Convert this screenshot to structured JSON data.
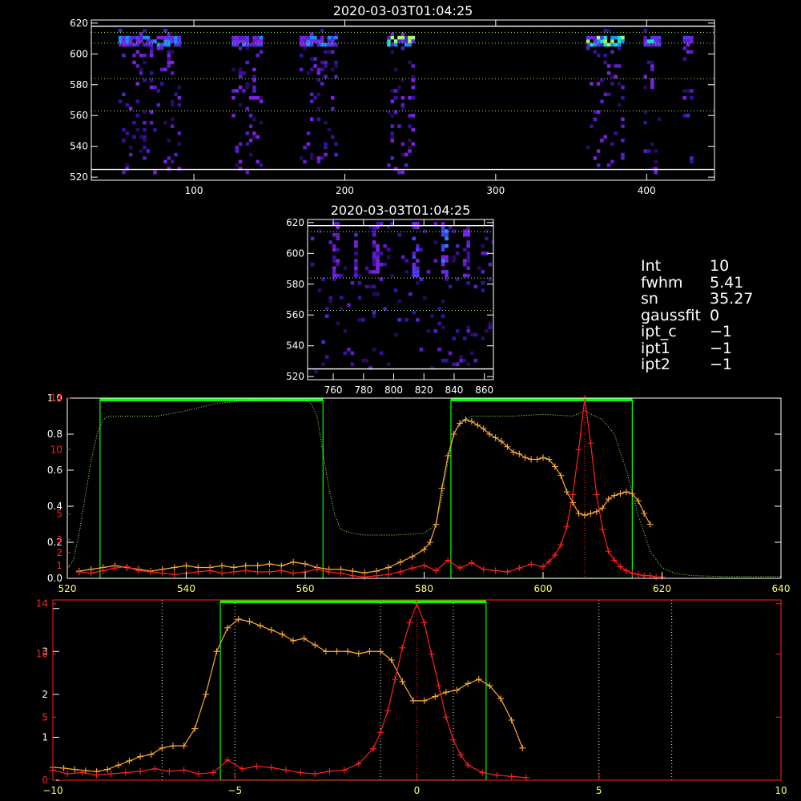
{
  "panel1": {
    "title": "2020-03-03T01:04:25",
    "xticks": [
      100,
      200,
      300,
      400
    ],
    "yticks": [
      520,
      540,
      560,
      580,
      600,
      620
    ],
    "xlim": [
      32,
      445
    ],
    "ylim": [
      518,
      622
    ],
    "white_lines": [
      525,
      618
    ],
    "dotted_lines": [
      563,
      584,
      607,
      614
    ]
  },
  "panel2": {
    "title": "2020-03-03T01:04:25",
    "xticks": [
      760,
      780,
      800,
      820,
      840,
      860
    ],
    "yticks": [
      520,
      540,
      560,
      580,
      600,
      620
    ],
    "xlim": [
      743,
      866
    ],
    "ylim": [
      518,
      622
    ],
    "white_lines": [
      525,
      618
    ],
    "dotted_lines": [
      563,
      584,
      614
    ]
  },
  "info": [
    {
      "key": "Int",
      "value": "10"
    },
    {
      "key": "fwhm",
      "value": "5.41"
    },
    {
      "key": "sn",
      "value": "35.27"
    },
    {
      "key": "gaussfit",
      "value": "0"
    },
    {
      "key": "ipt_c",
      "value": "−1"
    },
    {
      "key": "ipt1",
      "value": "−1"
    },
    {
      "key": "ipt2",
      "value": "−1"
    }
  ],
  "colors": {
    "axis": "#ffffff",
    "red": "#ff2020",
    "orange": "#ffaa33",
    "green": "#00ff00",
    "greenDot": "#9eff6a",
    "yellow": "#ffff66"
  },
  "chart_data": [
    {
      "type": "line",
      "panel": "spectrum",
      "xlim": [
        520,
        640
      ],
      "xticks": [
        520,
        540,
        560,
        580,
        600,
        620,
        640
      ],
      "left_axis_white": [
        0.0,
        0.2,
        0.4,
        0.6,
        0.8,
        1.0
      ],
      "left_axis_red": [
        1,
        2,
        3,
        5,
        10,
        14
      ],
      "left_axis_red_labels": [
        "1",
        "2",
        "3",
        "5",
        "10",
        "14"
      ],
      "green_bands": [
        [
          525.5,
          563
        ],
        [
          584.5,
          615
        ]
      ],
      "red_peak_x": 607,
      "series": [
        {
          "color": "green_dotted",
          "x": [
            520,
            521,
            522,
            523,
            524,
            525,
            526,
            527,
            528,
            530,
            535,
            540,
            545,
            548,
            550,
            555,
            560,
            561,
            562,
            563,
            564,
            565,
            566,
            568,
            570,
            575,
            580,
            582,
            583,
            584,
            585,
            586,
            588,
            590,
            595,
            600,
            605,
            607,
            610,
            612,
            614,
            616,
            618,
            620,
            622,
            625,
            630,
            635,
            640
          ],
          "y": [
            0.05,
            0.1,
            0.25,
            0.45,
            0.65,
            0.8,
            0.88,
            0.9,
            0.9,
            0.9,
            0.9,
            0.93,
            0.97,
            0.98,
            0.99,
            0.99,
            0.99,
            0.97,
            0.9,
            0.7,
            0.5,
            0.35,
            0.27,
            0.25,
            0.24,
            0.24,
            0.25,
            0.3,
            0.45,
            0.65,
            0.8,
            0.87,
            0.9,
            0.9,
            0.9,
            0.91,
            0.9,
            0.93,
            0.88,
            0.8,
            0.6,
            0.35,
            0.15,
            0.06,
            0.03,
            0.015,
            0.01,
            0.01,
            0.01
          ]
        },
        {
          "color": "orange",
          "x": [
            522,
            524,
            526,
            528,
            530,
            532,
            534,
            536,
            538,
            540,
            542,
            544,
            546,
            548,
            550,
            552,
            554,
            556,
            558,
            560,
            562,
            564,
            566,
            568,
            570,
            572,
            574,
            576,
            578,
            580,
            581,
            582,
            583,
            584,
            585,
            586,
            587,
            588,
            589,
            590,
            591,
            592,
            593,
            594,
            595,
            596,
            597,
            598,
            599,
            600,
            601,
            602,
            603,
            604,
            605,
            606,
            607,
            608,
            609,
            610,
            611,
            612,
            613,
            614,
            615,
            616,
            617,
            618
          ],
          "y": [
            0.04,
            0.05,
            0.06,
            0.07,
            0.06,
            0.05,
            0.04,
            0.05,
            0.06,
            0.07,
            0.06,
            0.06,
            0.07,
            0.06,
            0.07,
            0.07,
            0.08,
            0.07,
            0.09,
            0.08,
            0.06,
            0.05,
            0.05,
            0.04,
            0.03,
            0.04,
            0.06,
            0.09,
            0.12,
            0.16,
            0.2,
            0.3,
            0.5,
            0.68,
            0.8,
            0.86,
            0.88,
            0.87,
            0.85,
            0.83,
            0.8,
            0.78,
            0.76,
            0.73,
            0.7,
            0.69,
            0.67,
            0.66,
            0.66,
            0.67,
            0.66,
            0.62,
            0.57,
            0.48,
            0.42,
            0.36,
            0.35,
            0.36,
            0.37,
            0.39,
            0.44,
            0.46,
            0.47,
            0.48,
            0.47,
            0.43,
            0.36,
            0.3
          ]
        },
        {
          "color": "red",
          "x": [
            522,
            524,
            526,
            528,
            530,
            532,
            534,
            536,
            538,
            540,
            542,
            544,
            546,
            548,
            550,
            552,
            554,
            556,
            558,
            560,
            562,
            564,
            566,
            568,
            570,
            572,
            574,
            576,
            578,
            580,
            582,
            584,
            586,
            588,
            590,
            592,
            594,
            596,
            598,
            600,
            601,
            602,
            603,
            604,
            605,
            606,
            607,
            608,
            609,
            610,
            611,
            612,
            613,
            614,
            615,
            616,
            617,
            618,
            619,
            620
          ],
          "y": [
            0.5,
            0.4,
            0.6,
            0.8,
            0.9,
            0.6,
            0.5,
            0.4,
            0.3,
            0.4,
            0.5,
            0.6,
            0.4,
            0.5,
            0.6,
            0.5,
            0.5,
            0.6,
            0.4,
            0.5,
            0.7,
            0.5,
            0.4,
            0.2,
            0.1,
            0.2,
            0.3,
            0.5,
            0.8,
            1.0,
            0.6,
            1.4,
            0.8,
            1.2,
            0.7,
            0.6,
            0.5,
            0.8,
            1.1,
            0.9,
            1.3,
            1.8,
            2.6,
            4.0,
            6.5,
            10.0,
            14.0,
            10.5,
            6.5,
            3.8,
            2.1,
            1.4,
            0.9,
            0.6,
            0.4,
            0.3,
            0.2,
            0.2,
            0.1,
            0.1
          ]
        }
      ]
    },
    {
      "type": "line",
      "panel": "velocity",
      "xlim": [
        -10,
        10
      ],
      "xticks": [
        -10,
        -5,
        0,
        5,
        10
      ],
      "left_axis_white": [
        0,
        1,
        2,
        3,
        4
      ],
      "left_axis_red": [
        0,
        5,
        10,
        14
      ],
      "left_axis_red_labels": [
        "0",
        "5",
        "10",
        "14"
      ],
      "green_band": [
        -5.4,
        1.9
      ],
      "dotted_x": [
        -7,
        -5,
        -1,
        1,
        5,
        7
      ],
      "red_peak_x": 0,
      "series": [
        {
          "color": "orange",
          "x": [
            -10,
            -9.7,
            -9.4,
            -9.1,
            -8.8,
            -8.5,
            -8.2,
            -7.9,
            -7.6,
            -7.3,
            -7.0,
            -6.7,
            -6.4,
            -6.1,
            -5.8,
            -5.5,
            -5.2,
            -4.9,
            -4.6,
            -4.3,
            -4.0,
            -3.7,
            -3.4,
            -3.1,
            -2.8,
            -2.5,
            -2.2,
            -1.9,
            -1.6,
            -1.3,
            -1.0,
            -0.7,
            -0.4,
            -0.1,
            0.2,
            0.5,
            0.8,
            1.1,
            1.4,
            1.7,
            2.0,
            2.3,
            2.6,
            2.9
          ],
          "y": [
            0.3,
            0.28,
            0.25,
            0.22,
            0.2,
            0.25,
            0.35,
            0.45,
            0.55,
            0.6,
            0.75,
            0.8,
            0.8,
            1.2,
            2.0,
            3.0,
            3.55,
            3.75,
            3.7,
            3.6,
            3.5,
            3.4,
            3.25,
            3.3,
            3.15,
            3.0,
            3.0,
            3.0,
            2.95,
            3.0,
            3.0,
            2.8,
            2.3,
            1.85,
            1.85,
            1.95,
            2.05,
            2.1,
            2.25,
            2.35,
            2.2,
            1.9,
            1.4,
            0.75
          ]
        },
        {
          "color": "red",
          "x": [
            -10,
            -9.6,
            -9.2,
            -8.8,
            -8.4,
            -8.0,
            -7.6,
            -7.2,
            -6.8,
            -6.4,
            -6.0,
            -5.6,
            -5.2,
            -4.8,
            -4.4,
            -4.0,
            -3.6,
            -3.2,
            -2.8,
            -2.4,
            -2.0,
            -1.6,
            -1.2,
            -1.0,
            -0.8,
            -0.6,
            -0.4,
            -0.2,
            0.0,
            0.2,
            0.4,
            0.6,
            0.8,
            1.0,
            1.2,
            1.4,
            1.8,
            2.2,
            2.6,
            3.0
          ],
          "y": [
            0.8,
            0.5,
            0.6,
            0.4,
            0.5,
            0.6,
            0.7,
            0.9,
            0.7,
            0.8,
            0.5,
            0.6,
            1.6,
            0.9,
            1.1,
            1.0,
            0.8,
            0.6,
            0.5,
            0.7,
            0.8,
            1.3,
            2.5,
            3.8,
            5.5,
            8.0,
            10.5,
            12.5,
            14.0,
            12.5,
            10.0,
            7.5,
            5.0,
            3.2,
            2.0,
            1.2,
            0.6,
            0.4,
            0.3,
            0.2
          ]
        }
      ]
    }
  ]
}
